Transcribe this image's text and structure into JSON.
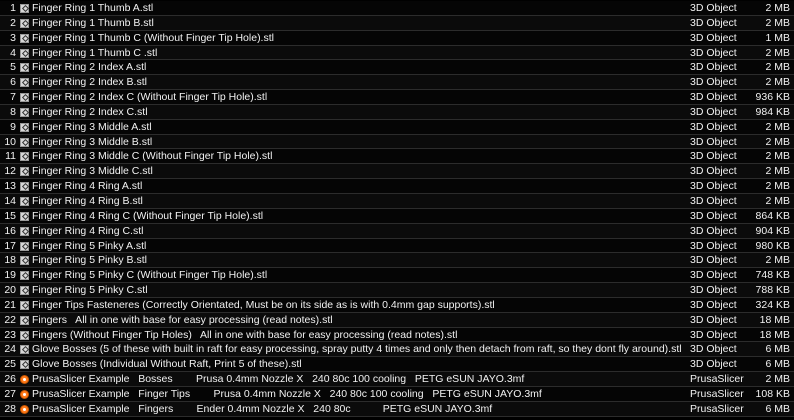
{
  "files": [
    {
      "num": "1",
      "name": "Finger Ring 1 Thumb A.stl",
      "type": "3D Object",
      "size": "2 MB",
      "icon": "stl-file-icon"
    },
    {
      "num": "2",
      "name": "Finger Ring 1 Thumb B.stl",
      "type": "3D Object",
      "size": "2 MB",
      "icon": "stl-file-icon"
    },
    {
      "num": "3",
      "name": "Finger Ring 1 Thumb C (Without Finger Tip Hole).stl",
      "type": "3D Object",
      "size": "1 MB",
      "icon": "stl-file-icon"
    },
    {
      "num": "4",
      "name": "Finger Ring 1 Thumb C .stl",
      "type": "3D Object",
      "size": "2 MB",
      "icon": "stl-file-icon"
    },
    {
      "num": "5",
      "name": "Finger Ring 2 Index A.stl",
      "type": "3D Object",
      "size": "2 MB",
      "icon": "stl-file-icon"
    },
    {
      "num": "6",
      "name": "Finger Ring 2 Index B.stl",
      "type": "3D Object",
      "size": "2 MB",
      "icon": "stl-file-icon"
    },
    {
      "num": "7",
      "name": "Finger Ring 2 Index C (Without Finger Tip Hole).stl",
      "type": "3D Object",
      "size": "936 KB",
      "icon": "stl-file-icon"
    },
    {
      "num": "8",
      "name": "Finger Ring 2 Index C.stl",
      "type": "3D Object",
      "size": "984 KB",
      "icon": "stl-file-icon"
    },
    {
      "num": "9",
      "name": "Finger Ring 3 Middle A.stl",
      "type": "3D Object",
      "size": "2 MB",
      "icon": "stl-file-icon"
    },
    {
      "num": "10",
      "name": "Finger Ring 3 Middle B.stl",
      "type": "3D Object",
      "size": "2 MB",
      "icon": "stl-file-icon"
    },
    {
      "num": "11",
      "name": "Finger Ring 3 Middle C (Without Finger Tip Hole).stl",
      "type": "3D Object",
      "size": "2 MB",
      "icon": "stl-file-icon"
    },
    {
      "num": "12",
      "name": "Finger Ring 3 Middle C.stl",
      "type": "3D Object",
      "size": "2 MB",
      "icon": "stl-file-icon"
    },
    {
      "num": "13",
      "name": "Finger Ring 4 Ring A.stl",
      "type": "3D Object",
      "size": "2 MB",
      "icon": "stl-file-icon"
    },
    {
      "num": "14",
      "name": "Finger Ring 4 Ring B.stl",
      "type": "3D Object",
      "size": "2 MB",
      "icon": "stl-file-icon"
    },
    {
      "num": "15",
      "name": "Finger Ring 4 Ring C (Without Finger Tip Hole).stl",
      "type": "3D Object",
      "size": "864 KB",
      "icon": "stl-file-icon"
    },
    {
      "num": "16",
      "name": "Finger Ring 4 Ring C.stl",
      "type": "3D Object",
      "size": "904 KB",
      "icon": "stl-file-icon"
    },
    {
      "num": "17",
      "name": "Finger Ring 5 Pinky A.stl",
      "type": "3D Object",
      "size": "980 KB",
      "icon": "stl-file-icon"
    },
    {
      "num": "18",
      "name": "Finger Ring 5 Pinky B.stl",
      "type": "3D Object",
      "size": "2 MB",
      "icon": "stl-file-icon"
    },
    {
      "num": "19",
      "name": "Finger Ring 5 Pinky C (Without Finger Tip Hole).stl",
      "type": "3D Object",
      "size": "748 KB",
      "icon": "stl-file-icon"
    },
    {
      "num": "20",
      "name": "Finger Ring 5 Pinky C.stl",
      "type": "3D Object",
      "size": "788 KB",
      "icon": "stl-file-icon"
    },
    {
      "num": "21",
      "name": "Finger Tips Fasteneres (Correctly Orientated, Must be on its side as is with 0.4mm gap supports).stl",
      "type": "3D Object",
      "size": "324 KB",
      "icon": "stl-file-icon"
    },
    {
      "num": "22",
      "name": "Fingers   All in one with base for easy processing (read notes).stl",
      "type": "3D Object",
      "size": "18 MB",
      "icon": "stl-file-icon"
    },
    {
      "num": "23",
      "name": "Fingers (Without Finger Tip Holes)   All in one with base for easy processing (read notes).stl",
      "type": "3D Object",
      "size": "18 MB",
      "icon": "stl-file-icon"
    },
    {
      "num": "24",
      "name": "Glove Bosses (5 of these with built in raft for easy processing, spray putty 4 times and only then detach from raft, so they dont fly around).stl",
      "type": "3D Object",
      "size": "6 MB",
      "icon": "stl-file-icon"
    },
    {
      "num": "25",
      "name": "Glove Bosses (Individual Without Raft, Print 5 of these).stl",
      "type": "3D Object",
      "size": "6 MB",
      "icon": "stl-file-icon"
    },
    {
      "num": "26",
      "name": "PrusaSlicer Example   Bosses        Prusa 0.4mm Nozzle X   240 80c 100 cooling   PETG eSUN JAYO.3mf",
      "type": "PrusaSlicer",
      "size": "2 MB",
      "icon": "prusaslicer-file-icon"
    },
    {
      "num": "27",
      "name": "PrusaSlicer Example   Finger Tips        Prusa 0.4mm Nozzle X   240 80c 100 cooling   PETG eSUN JAYO.3mf",
      "type": "PrusaSlicer",
      "size": "108 KB",
      "icon": "prusaslicer-file-icon"
    },
    {
      "num": "28",
      "name": "PrusaSlicer Example   Fingers        Ender 0.4mm Nozzle X   240 80c           PETG eSUN JAYO.3mf",
      "type": "PrusaSlicer",
      "size": "6 MB",
      "icon": "prusaslicer-file-icon"
    }
  ]
}
